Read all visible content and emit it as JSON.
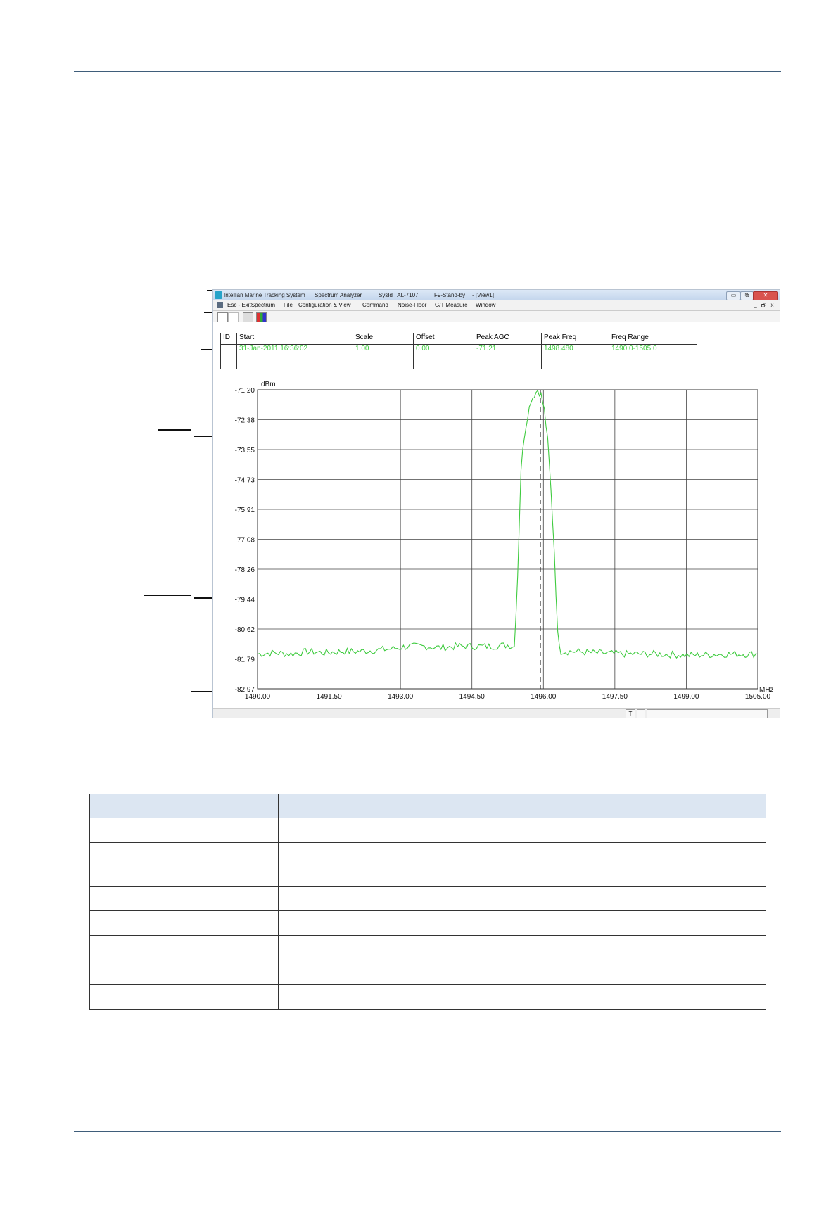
{
  "window": {
    "title_app": "Intellian Marine Tracking System",
    "title_mode": "Spectrum Analyzer",
    "title_sysid": "SysId : AL-7107",
    "title_status": "F9-Stand-by",
    "title_view": "- [View1]",
    "min_glyph": "▭",
    "max_glyph": "⧉",
    "close_glyph": "✕"
  },
  "menu": {
    "items": [
      "Esc - ExitSpectrum",
      "File",
      "Configuration & View",
      "Command",
      "Noise-Floor",
      "G/T Measure",
      "Window"
    ],
    "mdi_min": "_",
    "mdi_restore": "🗗",
    "mdi_close": "x"
  },
  "info_table": {
    "headers": [
      "ID",
      "Start",
      "Scale",
      "Offset",
      "Peak AGC",
      "Peak Freq",
      "Freq Range"
    ],
    "values": [
      "",
      "31-Jan-2011 16:36:02",
      "1.00",
      "0.00",
      "-71.21",
      "1498.480",
      "1490.0-1505.0"
    ]
  },
  "statusbar": {
    "box1": "T"
  },
  "chart_data": {
    "type": "line",
    "ylabel": "dBm",
    "xlabel": "MHz",
    "y_ticks": [
      "-71.20",
      "-72.38",
      "-73.55",
      "-74.73",
      "-75.91",
      "-77.08",
      "-78.26",
      "-79.44",
      "-80.62",
      "-81.79",
      "-82.97"
    ],
    "x_ticks": [
      "1490.00",
      "1491.50",
      "1493.00",
      "1494.50",
      "1496.00",
      "1497.50",
      "1499.00",
      "1505.00"
    ],
    "ylim": [
      -82.97,
      -71.2
    ],
    "xlim": [
      1490.0,
      1505.0
    ],
    "grid": true,
    "marker_x": 1498.48,
    "series": [
      {
        "color": "#3fcb3f",
        "x": [
          1490.0,
          1490.5,
          1491.0,
          1491.5,
          1492.0,
          1492.5,
          1493.0,
          1493.5,
          1494.0,
          1494.5,
          1495.0,
          1495.5,
          1496.0,
          1496.5,
          1497.0,
          1497.5,
          1497.7,
          1497.8,
          1497.9,
          1498.0,
          1498.1,
          1498.2,
          1498.3,
          1498.4,
          1498.5,
          1498.6,
          1498.7,
          1498.8,
          1498.9,
          1499.0,
          1499.1,
          1499.5,
          1500.0,
          1501.0,
          1502.0,
          1503.0,
          1504.0,
          1505.0
        ],
        "y": [
          -81.6,
          -81.55,
          -81.6,
          -81.5,
          -81.55,
          -81.5,
          -81.5,
          -81.45,
          -81.4,
          -81.3,
          -81.3,
          -81.35,
          -81.3,
          -81.3,
          -81.3,
          -81.25,
          -81.3,
          -78.5,
          -74.3,
          -73.0,
          -72.2,
          -71.6,
          -71.4,
          -71.2,
          -71.4,
          -72.0,
          -73.2,
          -75.2,
          -77.6,
          -80.8,
          -81.5,
          -81.5,
          -81.55,
          -81.6,
          -81.6,
          -81.65,
          -81.6,
          -81.6
        ]
      }
    ]
  },
  "desc_table": {
    "rows": 8
  }
}
